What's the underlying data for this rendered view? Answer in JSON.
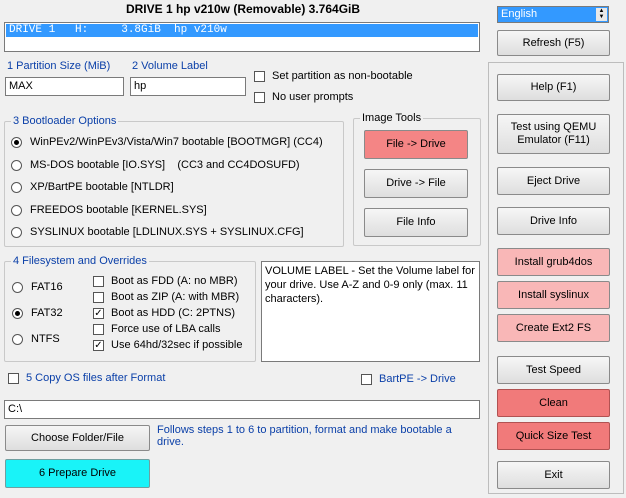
{
  "window_title": "DRIVE 1 hp v210w  (Removable) 3.764GiB",
  "drive_list": {
    "selected": "DRIVE 1   H:     3.8GiB  hp v210w"
  },
  "language": {
    "selected": "English"
  },
  "partition": {
    "size_label": "1 Partition Size (MiB)",
    "size_value": "MAX",
    "volume_label": "2 Volume Label",
    "volume_value": "hp",
    "non_bootable": "Set partition as non-bootable",
    "no_prompts": "No user prompts"
  },
  "bootloader": {
    "legend": "3 Bootloader Options",
    "options": [
      "WinPEv2/WinPEv3/Vista/Win7 bootable [BOOTMGR] (CC4)",
      "MS-DOS bootable [IO.SYS]    (CC3 and CC4DOSUFD)",
      "XP/BartPE bootable [NTLDR]",
      "FREEDOS bootable [KERNEL.SYS]",
      "SYSLINUX bootable [LDLINUX.SYS + SYSLINUX.CFG]"
    ],
    "selected_index": 0
  },
  "image_tools": {
    "legend": "Image Tools",
    "file_to_drive": "File -> Drive",
    "drive_to_file": "Drive -> File",
    "file_info": "File Info"
  },
  "filesystem": {
    "legend": "4 Filesystem and Overrides",
    "types": [
      "FAT16",
      "FAT32",
      "NTFS"
    ],
    "selected_type": 1,
    "overrides": [
      {
        "label": "Boot as FDD (A: no MBR)",
        "checked": false
      },
      {
        "label": "Boot as ZIP (A: with MBR)",
        "checked": false
      },
      {
        "label": "Boot as HDD (C: 2PTNS)",
        "checked": true
      },
      {
        "label": "Force use of LBA calls",
        "checked": false
      },
      {
        "label": "Use 64hd/32sec if possible",
        "checked": true
      }
    ]
  },
  "info_text": "VOLUME LABEL - Set the Volume label for your drive. Use A-Z and 0-9 only (max. 11 characters).",
  "copy_os": {
    "label": "5 Copy OS files after Format",
    "checked": false
  },
  "bartpe": {
    "label": "BartPE -> Drive",
    "checked": false
  },
  "path_value": "C:\\",
  "choose_folder": "Choose Folder/File",
  "hint": "Follows steps 1 to 6 to partition, format and make bootable a drive.",
  "prepare": "6 Prepare Drive",
  "right": {
    "refresh": "Refresh (F5)",
    "help": "Help (F1)",
    "qemu": "Test using QEMU Emulator (F11)",
    "eject": "Eject Drive",
    "drive_info": "Drive Info",
    "grub": "Install grub4dos",
    "syslinux": "Install syslinux",
    "ext2": "Create Ext2 FS",
    "speed": "Test Speed",
    "clean": "Clean",
    "quick_size": "Quick Size Test",
    "exit": "Exit"
  },
  "colors": {
    "selection": "#3399ff",
    "blue_text": "#0a3fa8",
    "pink": "#f9b7b7",
    "red": "#f17a7a",
    "cyan": "#19f3f8"
  }
}
